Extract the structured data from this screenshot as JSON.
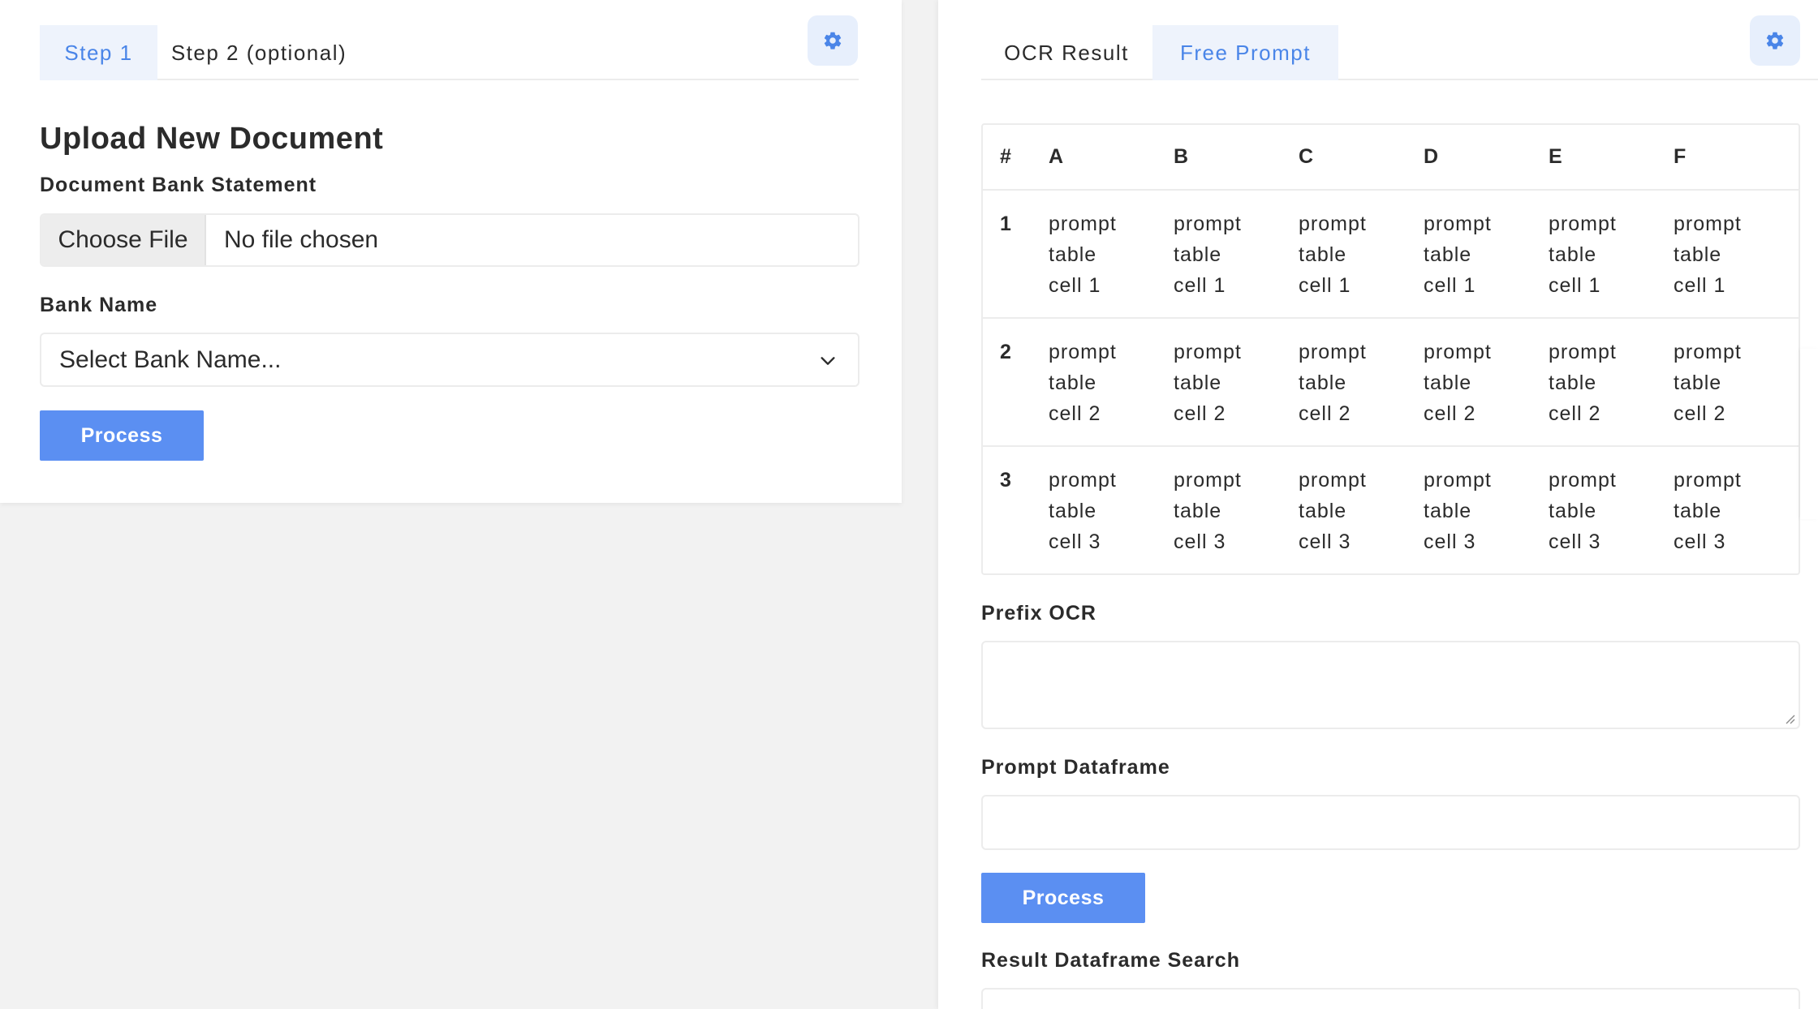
{
  "left": {
    "tabs": [
      {
        "label": "Step 1",
        "active": true
      },
      {
        "label": "Step 2 (optional)",
        "active": false
      }
    ],
    "settings_icon": "gear-icon",
    "heading": "Upload New Document",
    "document_label": "Document Bank Statement",
    "file_button": "Choose File",
    "file_status": "No file chosen",
    "bank_label": "Bank Name",
    "bank_select_value": "Select Bank Name...",
    "process_button": "Process"
  },
  "right": {
    "tabs": [
      {
        "label": "OCR Result",
        "active": false
      },
      {
        "label": "Free Prompt",
        "active": true
      }
    ],
    "settings_icon": "gear-icon",
    "table": {
      "headers": [
        "#",
        "A",
        "B",
        "C",
        "D",
        "E",
        "F"
      ],
      "rows": [
        {
          "index": "1",
          "cells": [
            "prompt table cell 1",
            "prompt table cell 1",
            "prompt table cell 1",
            "prompt table cell 1",
            "prompt table cell 1",
            "prompt table cell 1"
          ]
        },
        {
          "index": "2",
          "cells": [
            "prompt table cell 2",
            "prompt table cell 2",
            "prompt table cell 2",
            "prompt table cell 2",
            "prompt table cell 2",
            "prompt table cell 2"
          ]
        },
        {
          "index": "3",
          "cells": [
            "prompt table cell 3",
            "prompt table cell 3",
            "prompt table cell 3",
            "prompt table cell 3",
            "prompt table cell 3",
            "prompt table cell 3"
          ]
        }
      ]
    },
    "prefix_label": "Prefix OCR",
    "prefix_value": "",
    "dataframe_label": "Prompt Dataframe",
    "dataframe_value": "",
    "process_button": "Process",
    "search_label": "Result Dataframe Search",
    "search_value": ""
  },
  "colors": {
    "accent": "#5b8ff2",
    "tab_active_text": "#4a85e8",
    "tab_active_bg": "#eef3fc",
    "gear_bg": "#e7effc",
    "page_bg": "#f2f2f2"
  }
}
